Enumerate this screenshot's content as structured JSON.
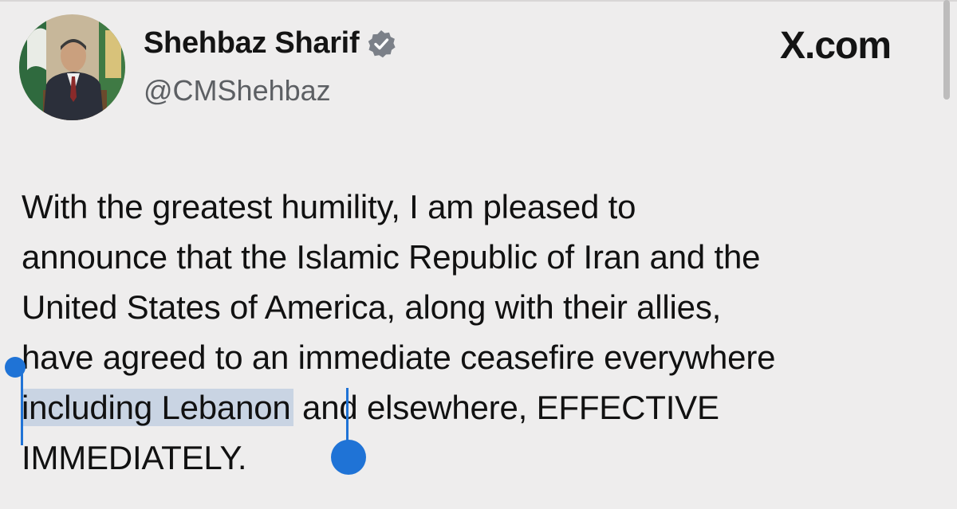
{
  "colors": {
    "background": "#eeeded",
    "text": "#111111",
    "handle_text": "#5c5f63",
    "verified_badge": "#7b8088",
    "selection_highlight": "#c9d4e3",
    "selection_handle": "#1f73d6"
  },
  "profile": {
    "display_name": "Shehbaz Sharif",
    "handle": "@CMShehbaz",
    "verified_icon": "verified-badge-icon"
  },
  "brand": {
    "label": "X.com"
  },
  "tweet": {
    "lines": {
      "l1": "With the greatest humility, I am pleased to",
      "l2": "announce that the Islamic Republic of Iran and the",
      "l3": "United States of America, along with their allies,",
      "l4": "have agreed to an immediate ceasefire everywhere",
      "l5_selected": "including Lebanon",
      "l5_rest": " and elsewhere, EFFECTIVE",
      "l6": "IMMEDIATELY."
    }
  }
}
